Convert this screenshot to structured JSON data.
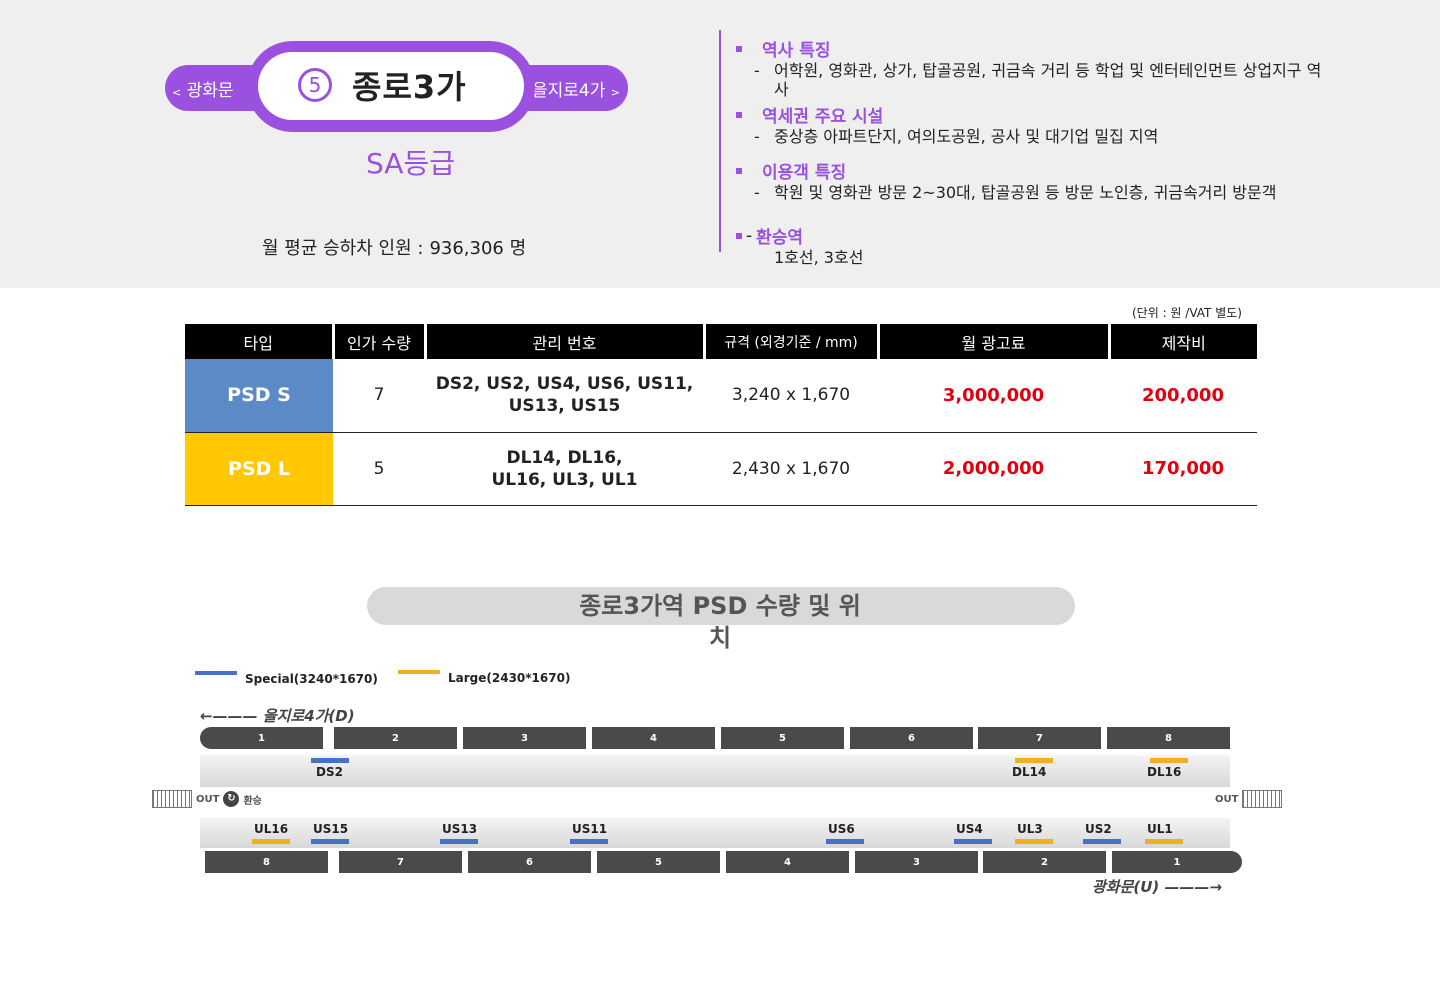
{
  "header": {
    "prev_station": "광화문",
    "next_station": "을지로4가",
    "prev_arrow": "<",
    "next_arrow": ">",
    "line_number": "5",
    "station_name": "종로3가",
    "grade": "SA등급",
    "monthly_label": "월 평균 승하차 인원 :",
    "monthly_value": "936,306 명",
    "line_color": "#9b51e0"
  },
  "info": [
    {
      "title": "역사 특징",
      "body": "어학원, 영화관, 상가, 탑골공원, 귀금속 거리 등 학업 및 엔터테인먼트 상업지구 역사",
      "dash": "-"
    },
    {
      "title": "역세권 주요 시설",
      "body": "중상층 아파트단지, 여의도공원, 공사 및 대기업 밀집 지역",
      "dash": "-"
    },
    {
      "title": "이용객 특징",
      "body": "학원 및 영화관 방문 2~30대, 탑골공원 등 방문 노인층, 귀금속거리 방문객",
      "dash": "-"
    },
    {
      "title": "환승역",
      "body": "1호선, 3호선",
      "dash": "-"
    }
  ],
  "table": {
    "unit": "(단위 : 원 /VAT 별도)",
    "headers": [
      "타입",
      "인가 수량",
      "관리 번호",
      "규격 (외경기준 / mm)",
      "월 광고료",
      "제작비"
    ],
    "rows": [
      {
        "type": "PSD S",
        "count": "7",
        "mgmt_1": "DS2, US2, US4, US6, US11,",
        "mgmt_2": "US13, US15",
        "size": "3,240 x 1,670",
        "fee": "3,000,000",
        "production": "200,000",
        "color": "#5b8ac6"
      },
      {
        "type": "PSD L",
        "count": "5",
        "mgmt_1": "DL14, DL16,",
        "mgmt_2": "UL16, UL3, UL1",
        "size": "2,430 x 1,670",
        "fee": "2,000,000",
        "production": "170,000",
        "color": "#ffc800"
      }
    ]
  },
  "map": {
    "title_1": "종로3가역  PSD 수량 및 위",
    "title_2": "치",
    "legend_special": "Special(3240*1670)",
    "legend_large": "Large(2430*1670)",
    "special_color": "#4472c4",
    "large_color": "#f0b020",
    "dir_top": "을지로4가(D)",
    "dir_bottom": "광화문(U)",
    "exit_out": "OUT",
    "transfer": "환승",
    "top_cars": [
      "1",
      "2",
      "3",
      "4",
      "5",
      "6",
      "7",
      "8"
    ],
    "bottom_cars": [
      "8",
      "7",
      "6",
      "5",
      "4",
      "3",
      "2",
      "1"
    ],
    "top_markers": [
      {
        "label": "DS2",
        "kind": "special"
      },
      {
        "label": "DL14",
        "kind": "large"
      },
      {
        "label": "DL16",
        "kind": "large"
      }
    ],
    "bottom_markers": [
      {
        "label": "UL16",
        "kind": "large"
      },
      {
        "label": "US15",
        "kind": "special"
      },
      {
        "label": "US13",
        "kind": "special"
      },
      {
        "label": "US11",
        "kind": "special"
      },
      {
        "label": "US6",
        "kind": "special"
      },
      {
        "label": "US4",
        "kind": "special"
      },
      {
        "label": "UL3",
        "kind": "large"
      },
      {
        "label": "US2",
        "kind": "special"
      },
      {
        "label": "UL1",
        "kind": "large"
      }
    ]
  }
}
